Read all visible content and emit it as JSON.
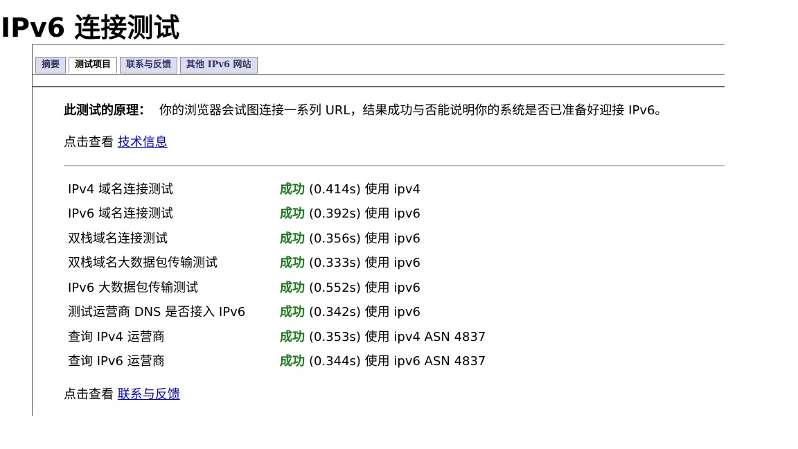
{
  "page": {
    "title": "IPv6 连接测试"
  },
  "tabs": [
    {
      "label": "摘要",
      "active": false
    },
    {
      "label": "测试项目",
      "active": true
    },
    {
      "label": "联系与反馈",
      "active": false
    },
    {
      "label": "其他 IPv6 网站",
      "active": false
    }
  ],
  "principle": {
    "label": "此测试的原理：",
    "text": "你的浏览器会试图连接一系列 URL，结果成功与否能说明你的系统是否已准备好迎接 IPv6。"
  },
  "tech_info": {
    "prefix": "点击查看",
    "link": "技术信息"
  },
  "results": [
    {
      "name": "IPv4 域名连接测试",
      "status": "成功",
      "detail": "(0.414s) 使用 ipv4"
    },
    {
      "name": "IPv6 域名连接测试",
      "status": "成功",
      "detail": "(0.392s) 使用 ipv6"
    },
    {
      "name": "双栈域名连接测试",
      "status": "成功",
      "detail": "(0.356s) 使用 ipv6"
    },
    {
      "name": "双栈域名大数据包传输测试",
      "status": "成功",
      "detail": "(0.333s) 使用 ipv6"
    },
    {
      "name": "IPv6 大数据包传输测试",
      "status": "成功",
      "detail": "(0.552s) 使用 ipv6"
    },
    {
      "name": "测试运营商 DNS 是否接入 IPv6",
      "status": "成功",
      "detail": "(0.342s) 使用 ipv6"
    },
    {
      "name": "查询 IPv4 运营商",
      "status": "成功",
      "detail": "(0.353s) 使用 ipv4 ASN 4837"
    },
    {
      "name": "查询 IPv6 运营商",
      "status": "成功",
      "detail": "(0.344s) 使用 ipv6 ASN 4837"
    }
  ],
  "feedback": {
    "prefix": "点击查看",
    "link": "联系与反馈"
  },
  "colors": {
    "success": "#1a7a1a",
    "link": "#0000cc",
    "tab_bg": "#dcdcee"
  }
}
